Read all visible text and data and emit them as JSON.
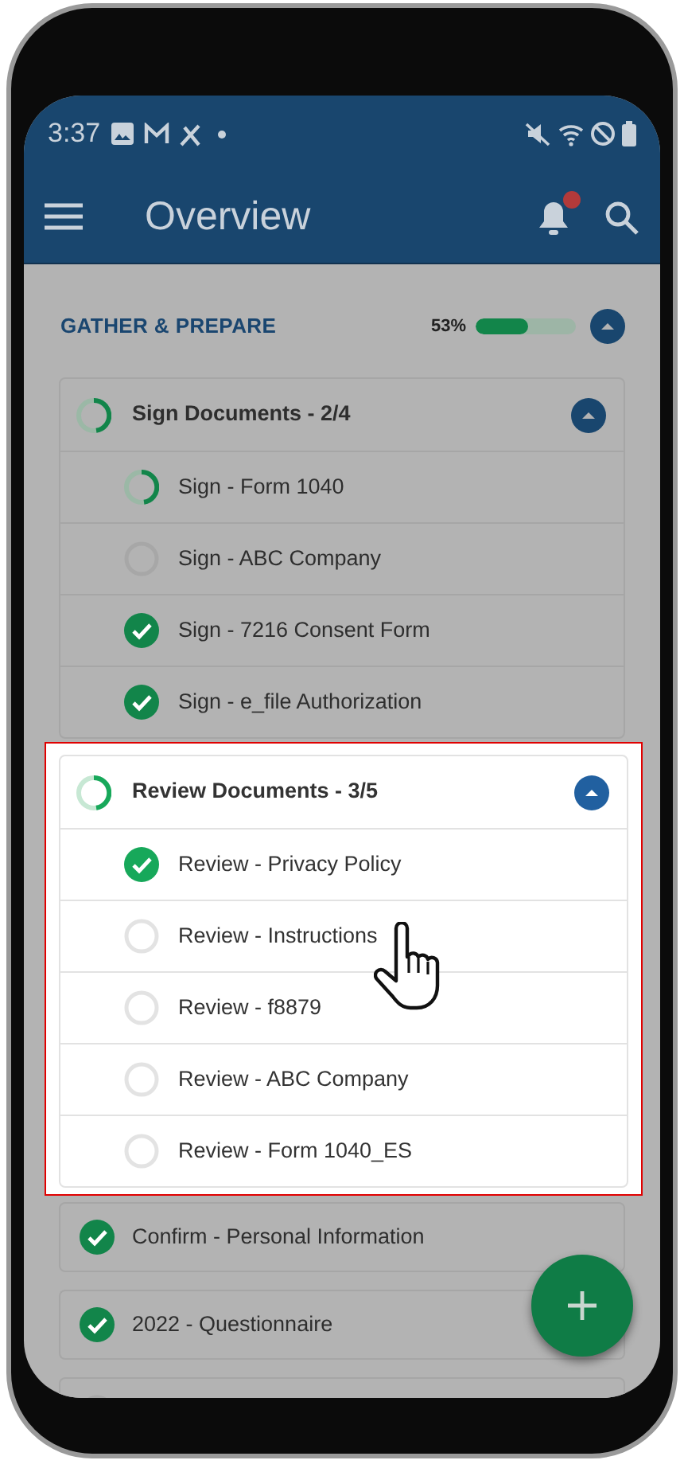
{
  "status_bar": {
    "time": "3:37"
  },
  "app_bar": {
    "title": "Overview",
    "notification_badge": true
  },
  "section": {
    "title": "GATHER & PREPARE",
    "percent": "53%",
    "level": 0.53,
    "expanded": true
  },
  "groups": [
    {
      "title": "Sign Documents - 2/4",
      "kind": "partial",
      "expanded": true,
      "highlighted": false,
      "items": [
        {
          "title": "Sign - Form 1040",
          "kind": "partial"
        },
        {
          "title": "Sign - ABC Company",
          "kind": "empty"
        },
        {
          "title": "Sign - 7216 Consent Form",
          "kind": "done"
        },
        {
          "title": "Sign - e_file Authorization",
          "kind": "done"
        }
      ]
    },
    {
      "title": "Review Documents - 3/5",
      "kind": "partial",
      "expanded": true,
      "highlighted": true,
      "items": [
        {
          "title": "Review - Privacy Policy",
          "kind": "done"
        },
        {
          "title": "Review - Instructions",
          "kind": "empty"
        },
        {
          "title": "Review - f8879",
          "kind": "empty"
        },
        {
          "title": "Review - ABC Company",
          "kind": "empty"
        },
        {
          "title": "Review - Form 1040_ES",
          "kind": "empty"
        }
      ]
    }
  ],
  "tasks": [
    {
      "title": "Confirm - Personal Information",
      "kind": "done"
    },
    {
      "title": "2022 - Questionnaire",
      "kind": "done"
    },
    {
      "kind": "empty"
    }
  ]
}
